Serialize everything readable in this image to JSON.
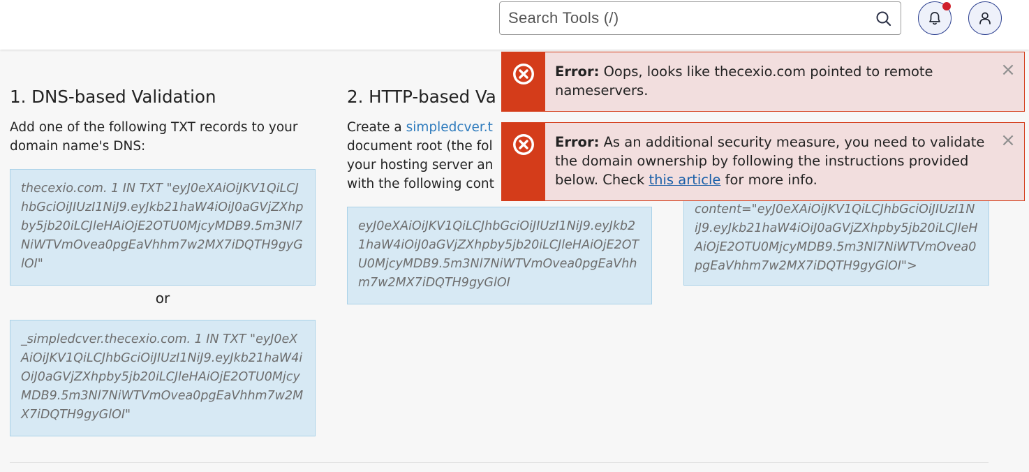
{
  "header": {
    "search_placeholder": "Search Tools (/)",
    "search_icon": "search-icon",
    "notifications_icon": "bell-icon",
    "user_icon": "user-icon"
  },
  "dns": {
    "title": "1. DNS-based Validation",
    "instruction": "Add one of the following TXT records to your domain name's DNS:",
    "record1": "thecexio.com. 1 IN TXT \"eyJ0eXAiOiJKV1QiLCJhbGciOiJIUzI1NiJ9.eyJkb21haW4iOiJ0aGVjZXhpby5jb20iLCJleHAiOjE2OTU0MjcyMDB9.5m3Nl7NiWTVmOvea0pgEaVhhm7w2MX7iDQTH9gyGlOI\"",
    "or_label": "or",
    "record2": "_simpledcver.thecexio.com. 1 IN TXT \"eyJ0eXAiOiJKV1QiLCJhbGciOiJIUzI1NiJ9.eyJkb21haW4iOiJ0aGVjZXhpby5jb20iLCJleHAiOjE2OTU0MjcyMDB9.5m3Nl7NiWTVmOvea0pgEaVhhm7w2MX7iDQTH9gyGlOI\""
  },
  "http": {
    "title": "2. HTTP-based Va",
    "instruction_pre": "Create a ",
    "instruction_link": "simpledcver.t",
    "instruction_post": " document root (the fol your hosting server an with the following cont",
    "code": "eyJ0eXAiOiJKV1QiLCJhbGciOiJIUzI1NiJ9.eyJkb21haW4iOiJ0aGVjZXhpby5jb20iLCJleHAiOjE2OTU0MjcyMDB9.5m3Nl7NiWTVmOvea0pgEaVhhm7w2MX7iDQTH9gyGlOI"
  },
  "meta": {
    "code": "content=\"eyJ0eXAiOiJKV1QiLCJhbGciOiJIUzI1NiJ9.eyJkb21haW4iOiJ0aGVjZXhpby5jb20iLCJleHAiOjE2OTU0MjcyMDB9.5m3Nl7NiWTVmOvea0pgEaVhhm7w2MX7iDQTH9gyGlOI\">"
  },
  "alerts": [
    {
      "label": "Error:",
      "message": " Oops, looks like thecexio.com pointed to remote nameservers.",
      "close": "×"
    },
    {
      "label": "Error:",
      "message_pre": " As an additional security measure, you need to validate the domain ownership by following the instructions provided below. Check ",
      "link": "this article",
      "message_post": " for more info.",
      "close": "×"
    }
  ],
  "colors": {
    "error_accent": "#d43c1a",
    "error_bg": "#f2dede",
    "code_bg": "#d7e9f4",
    "link": "#2e7bbd"
  }
}
